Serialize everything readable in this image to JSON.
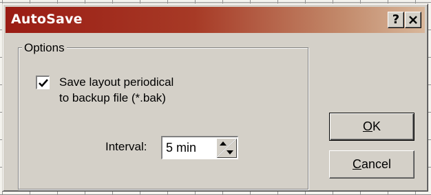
{
  "window": {
    "title": "AutoSave",
    "help_button": "?",
    "close_button": "✕"
  },
  "options_group": {
    "label": "Options",
    "save_checkbox": {
      "checked": true,
      "label_line1": "Save layout periodical",
      "label_line2": "to backup file (*.bak)"
    },
    "interval": {
      "label": "Interval:",
      "value": "5 min"
    }
  },
  "buttons": {
    "ok": {
      "mnemonic": "O",
      "rest": "K"
    },
    "cancel": {
      "mnemonic": "C",
      "rest": "ancel"
    }
  },
  "colors": {
    "title_bar_start": "#9a1c14",
    "title_bar_end": "#d8b79b",
    "dialog_face": "#d4d0c8"
  }
}
